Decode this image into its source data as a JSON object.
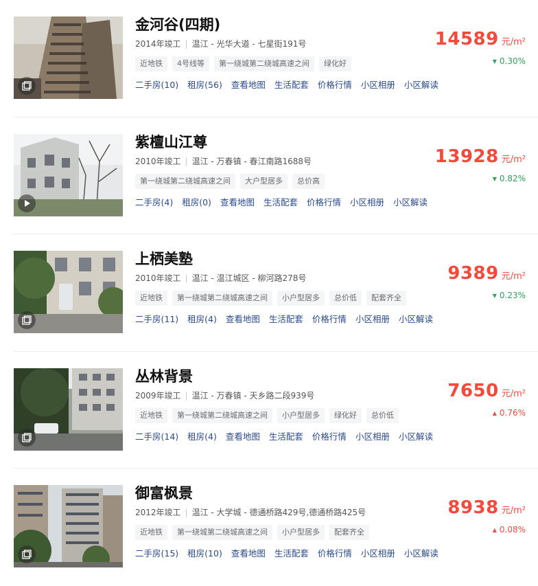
{
  "listings": [
    {
      "title": "金河谷(四期)",
      "year": "2014年竣工",
      "location": "温江 - 光华大道 - 七星街191号",
      "tags": [
        "近地铁",
        "4号线等",
        "第一绕城第二绕城高速之间",
        "绿化好"
      ],
      "links": [
        "二手房(10)",
        "租房(56)",
        "查看地图",
        "生活配套",
        "价格行情",
        "小区相册",
        "小区解读"
      ],
      "price": "14589",
      "unit": "元/m²",
      "change": "0.30%",
      "direction": "down",
      "arrow": "▼",
      "badge_icon": "album-icon"
    },
    {
      "title": "紫檀山江尊",
      "year": "2010年竣工",
      "location": "温江 - 万春镇 - 春江南路1688号",
      "tags": [
        "第一绕城第二绕城高速之间",
        "大户型居多",
        "总价高"
      ],
      "links": [
        "二手房(4)",
        "租房(0)",
        "查看地图",
        "生活配套",
        "价格行情",
        "小区相册",
        "小区解读"
      ],
      "price": "13928",
      "unit": "元/m²",
      "change": "0.82%",
      "direction": "down",
      "arrow": "▼",
      "badge_icon": "video-play-icon"
    },
    {
      "title": "上栖美塾",
      "year": "2010年竣工",
      "location": "温江 - 温江城区 - 柳河路278号",
      "tags": [
        "近地铁",
        "第一绕城第二绕城高速之间",
        "小户型居多",
        "总价低",
        "配套齐全"
      ],
      "links": [
        "二手房(11)",
        "租房(4)",
        "查看地图",
        "生活配套",
        "价格行情",
        "小区相册",
        "小区解读"
      ],
      "price": "9389",
      "unit": "元/m²",
      "change": "0.23%",
      "direction": "down",
      "arrow": "▼",
      "badge_icon": "album-icon"
    },
    {
      "title": "丛林背景",
      "year": "2009年竣工",
      "location": "温江 - 万春镇 - 天乡路二段939号",
      "tags": [
        "近地铁",
        "第一绕城第二绕城高速之间",
        "小户型居多",
        "绿化好",
        "总价低"
      ],
      "links": [
        "二手房(14)",
        "租房(4)",
        "查看地图",
        "生活配套",
        "价格行情",
        "小区相册",
        "小区解读"
      ],
      "price": "7650",
      "unit": "元/m²",
      "change": "0.76%",
      "direction": "up",
      "arrow": "▲",
      "badge_icon": "album-icon"
    },
    {
      "title": "御富枫景",
      "year": "2012年竣工",
      "location": "温江 - 大学城 - 德通桥路429号,德通桥路425号",
      "tags": [
        "近地铁",
        "第一绕城第二绕城高速之间",
        "小户型居多",
        "配套齐全"
      ],
      "links": [
        "二手房(15)",
        "租房(10)",
        "查看地图",
        "生活配套",
        "价格行情",
        "小区相册",
        "小区解读"
      ],
      "price": "8938",
      "unit": "元/m²",
      "change": "0.08%",
      "direction": "up",
      "arrow": "▲",
      "badge_icon": "album-icon"
    }
  ],
  "colors": {
    "price": "#f24a3b",
    "down": "#2ba25a",
    "up": "#f24a3b",
    "link": "#2a4a8f"
  }
}
